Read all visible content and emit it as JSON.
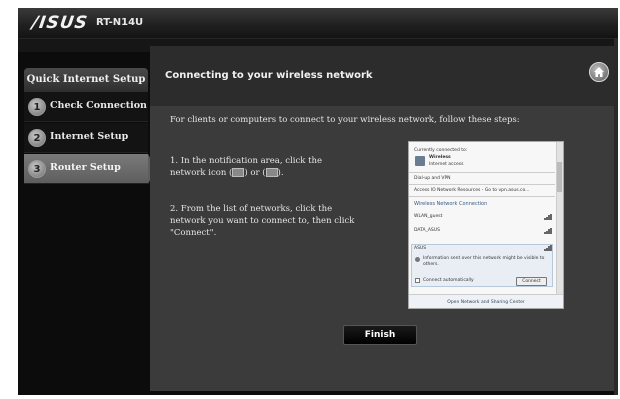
{
  "header": {
    "brand": "/ISUS",
    "model": "RT-N14U"
  },
  "sidebar": {
    "title": "Quick Internet Setup",
    "steps": [
      {
        "num": "1",
        "label": "Check Connection"
      },
      {
        "num": "2",
        "label": "Internet Setup"
      },
      {
        "num": "3",
        "label": "Router Setup"
      }
    ]
  },
  "main": {
    "title": "Connecting to your wireless network",
    "intro": "For clients or computers to connect to your wireless network, follow these steps:",
    "step1_a": "1. In the notification area, click the",
    "step1_b": "network icon (",
    "step1_c": ") or (",
    "step1_d": ").",
    "step2": "2. From the list of networks, click the network you want to connect to, then click \"Connect\".",
    "finish_label": "Finish"
  },
  "popup": {
    "currently": "Currently connected to:",
    "wireless": "Wireless",
    "internet_access": "Internet access",
    "dialup": "Dial-up and VPN",
    "access_remote": "Access IO Network Resources - Go to vpn.asus.co...",
    "wireless_conn": "Wireless Network Connection",
    "networks": [
      "WLAN_guest",
      "DATA_ASUS",
      "ASUS"
    ],
    "info": "Information sent over this network might be visible to others.",
    "connect_auto": "Connect automatically",
    "connect_btn": "Connect",
    "footer": "Open Network and Sharing Center"
  }
}
